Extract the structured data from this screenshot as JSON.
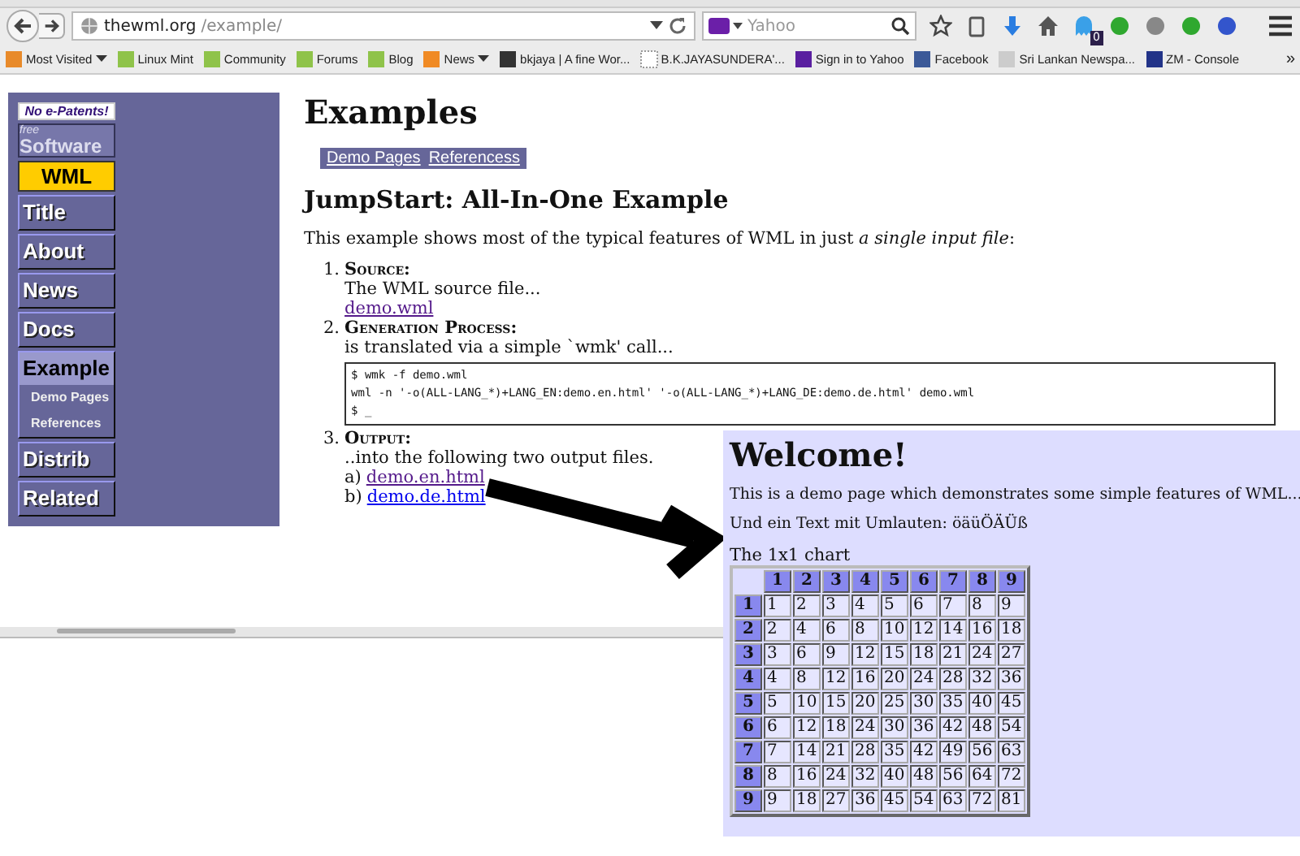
{
  "browser": {
    "url_host": "thewml.org",
    "url_path": "/example/",
    "search_placeholder": "Yahoo",
    "toolbar_icons": [
      {
        "kind": "star"
      },
      {
        "kind": "clipboard"
      },
      {
        "kind": "download"
      },
      {
        "kind": "home"
      },
      {
        "kind": "ghost",
        "badge": "0"
      },
      {
        "kind": "green"
      },
      {
        "kind": "grey"
      },
      {
        "kind": "green"
      },
      {
        "kind": "blue"
      }
    ],
    "bookmarks": [
      {
        "label": "Most Visited",
        "kind": "folder",
        "dropdown": true
      },
      {
        "label": "Linux Mint",
        "kind": "page"
      },
      {
        "label": "Community",
        "kind": "page"
      },
      {
        "label": "Forums",
        "kind": "page"
      },
      {
        "label": "Blog",
        "kind": "page"
      },
      {
        "label": "News",
        "kind": "feed",
        "dropdown": true
      },
      {
        "label": "bkjaya | A fine Wor...",
        "kind": "dark"
      },
      {
        "label": "B.K.JAYASUNDERA'...",
        "kind": "blank"
      },
      {
        "label": "Sign in to Yahoo",
        "kind": "yahoo"
      },
      {
        "label": "Facebook",
        "kind": "facebook"
      },
      {
        "label": "Sri Lankan Newspa...",
        "kind": "news"
      },
      {
        "label": "ZM - Console",
        "kind": "zm"
      }
    ],
    "overflow": "»"
  },
  "sidebar": {
    "banner": "No e-Patents!",
    "logo_small": "free",
    "logo_big": "Software",
    "brand": "WML",
    "items": [
      {
        "label": "Title",
        "selected": false
      },
      {
        "label": "About",
        "selected": false
      },
      {
        "label": "News",
        "selected": false
      },
      {
        "label": "Docs",
        "selected": false
      },
      {
        "label": "Example",
        "selected": true,
        "children": [
          {
            "label": "Demo Pages"
          },
          {
            "label": "References"
          }
        ]
      },
      {
        "label": "Distrib",
        "selected": false
      },
      {
        "label": "Related",
        "selected": false
      }
    ]
  },
  "main": {
    "title": "Examples",
    "subnav": [
      "Demo Pages",
      "Referencess"
    ],
    "heading": "JumpStart: All-In-One Example",
    "intro": "This example shows most of the typical features of WML in just *a single input file*:",
    "steps": [
      {
        "number": "1.",
        "title": "Source:",
        "text": "The WML source file...",
        "links": [
          {
            "label": "demo.wml",
            "visited": true
          }
        ]
      },
      {
        "number": "2.",
        "title": "Generation Process:",
        "text": "is translated via a simple `wmk' call...",
        "code": [
          "$ wmk -f demo.wml",
          "wml -n '-o(ALL-LANG_*)+LANG_EN:demo.en.html' '-o(ALL-LANG_*)+LANG_DE:demo.de.html' demo.wml",
          "$ _"
        ]
      },
      {
        "number": "3.",
        "title": "Output:",
        "text": "..into the following two output files.",
        "links": [
          {
            "prefix": "a)",
            "label": "demo.en.html",
            "visited": true
          },
          {
            "prefix": "b)",
            "label": "demo.de.html",
            "visited": false
          }
        ]
      }
    ]
  },
  "output_page": {
    "title": "Welcome!",
    "paragraphs": [
      "This is a demo page which demonstrates some simple features of WML...",
      "Und ein Text mit Umlauten: öäüÖÄÜß"
    ],
    "table_caption": "The 1x1 chart",
    "columns": [
      "1",
      "2",
      "3",
      "4",
      "5",
      "6",
      "7",
      "8",
      "9"
    ],
    "rows": [
      {
        "head": "1",
        "cells": [
          "1",
          "2",
          "3",
          "4",
          "5",
          "6",
          "7",
          "8",
          "9"
        ]
      },
      {
        "head": "2",
        "cells": [
          "2",
          "4",
          "6",
          "8",
          "10",
          "12",
          "14",
          "16",
          "18"
        ]
      },
      {
        "head": "3",
        "cells": [
          "3",
          "6",
          "9",
          "12",
          "15",
          "18",
          "21",
          "24",
          "27"
        ]
      },
      {
        "head": "4",
        "cells": [
          "4",
          "8",
          "12",
          "16",
          "20",
          "24",
          "28",
          "32",
          "36"
        ]
      },
      {
        "head": "5",
        "cells": [
          "5",
          "10",
          "15",
          "20",
          "25",
          "30",
          "35",
          "40",
          "45"
        ]
      },
      {
        "head": "6",
        "cells": [
          "6",
          "12",
          "18",
          "24",
          "30",
          "36",
          "42",
          "48",
          "54"
        ]
      },
      {
        "head": "7",
        "cells": [
          "7",
          "14",
          "21",
          "28",
          "35",
          "42",
          "49",
          "56",
          "63"
        ]
      },
      {
        "head": "8",
        "cells": [
          "8",
          "16",
          "24",
          "32",
          "40",
          "48",
          "56",
          "64",
          "72"
        ]
      },
      {
        "head": "9",
        "cells": [
          "9",
          "18",
          "27",
          "36",
          "45",
          "54",
          "63",
          "72",
          "81"
        ]
      }
    ]
  }
}
